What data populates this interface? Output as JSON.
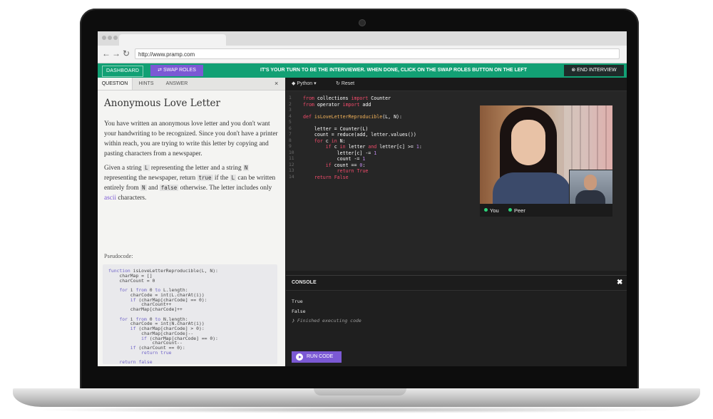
{
  "browser": {
    "url": "http://www.pramp.com"
  },
  "header": {
    "dashboard_label": "DASHBOARD",
    "swap_label": "SWAP ROLES",
    "message": "IT'S YOUR TURN TO BE THE INTERVIEWER. WHEN DONE, CLICK ON THE SWAP ROLES BUTTON ON THE LEFT",
    "end_label": "END INTERVIEW"
  },
  "left": {
    "tabs": [
      "QUESTION",
      "HINTS",
      "ANSWER"
    ],
    "close": "×",
    "title": "Anonymous Love Letter",
    "para1": "You have written an anonymous love letter and you don't want your handwriting to be recognized. Since you don't have a printer within reach, you are trying to write this letter by copying and pasting characters from a newspaper.",
    "p2": {
      "a": "Given a string ",
      "L": "L",
      "b": " representing the letter and a string ",
      "N": "N",
      "c": " representing the newspaper, return ",
      "true": "true",
      "d": " if the ",
      "L2": "L",
      "e": " can be written entirely from ",
      "N2": "N",
      "f": " and ",
      "false": "false",
      "g": " otherwise. The letter includes only ",
      "ascii": "ascii",
      "h": " characters."
    },
    "pseudo_label": "Pseudocode:",
    "pseudocode": [
      "function isLoveLetterReproducible(L, N):",
      "    charMap = []",
      "    charCount = 0",
      "",
      "    for i from 0 to L.length:",
      "        charCode = int(L.charAt(i))",
      "        if (charMap[charCode] == 0):",
      "            charCount++",
      "        charMap[charCode]++",
      "",
      "    for i from 0 to N.length:",
      "        charCode = int(N.charAt(i))",
      "        if (charMap[charCode] > 0):",
      "            charMap[charCode]--",
      "            if (charMap[charCode] == 0):",
      "                charCount--",
      "        if (charCount == 0):",
      "            return true",
      "",
      "    return false"
    ]
  },
  "editor": {
    "language": "Python",
    "reset_label": "Reset",
    "line_numbers": [
      "1",
      "2",
      "3",
      "4",
      "5",
      "6",
      "7",
      "8",
      "9",
      "10",
      "11",
      "12",
      "13",
      "14"
    ],
    "code": {
      "l1": {
        "a": "from",
        "b": " collections ",
        "c": "import",
        "d": " Counter"
      },
      "l2": {
        "a": "from",
        "b": " operator ",
        "c": "import",
        "d": " add"
      },
      "l4": {
        "a": "def",
        "b": " ",
        "c": "isLoveLetterReproducible",
        "d": "(L, N):"
      },
      "l6": "    letter = Counter(L)",
      "l7": "    count = reduce(add, letter.values())",
      "l8": {
        "a": "    ",
        "b": "for",
        "c": " c ",
        "d": "in",
        "e": " N:"
      },
      "l9": {
        "a": "        ",
        "b": "if",
        "c": " c ",
        "d": "in",
        "e": " letter ",
        "f": "and",
        "g": " letter[c] >= ",
        "h": "1",
        "i": ":"
      },
      "l10": {
        "a": "            letter[c] -= ",
        "b": "1"
      },
      "l11": {
        "a": "            count -= ",
        "b": "1"
      },
      "l12": {
        "a": "        ",
        "b": "if",
        "c": " count == ",
        "d": "0",
        "e": ":"
      },
      "l13": {
        "a": "            ",
        "b": "return",
        "c": " ",
        "d": "True"
      },
      "l14": {
        "a": "    ",
        "b": "return",
        "c": " ",
        "d": "False"
      }
    }
  },
  "video": {
    "you_label": "You",
    "peer_label": "Peer"
  },
  "console": {
    "title": "CONSOLE",
    "close": "✖",
    "lines": [
      "True",
      "False"
    ],
    "status": "❯ Finished executing code"
  },
  "run": {
    "label": "RUN CODE"
  },
  "colors": {
    "brand_green": "#12a074",
    "accent_purple": "#7b59d4"
  }
}
